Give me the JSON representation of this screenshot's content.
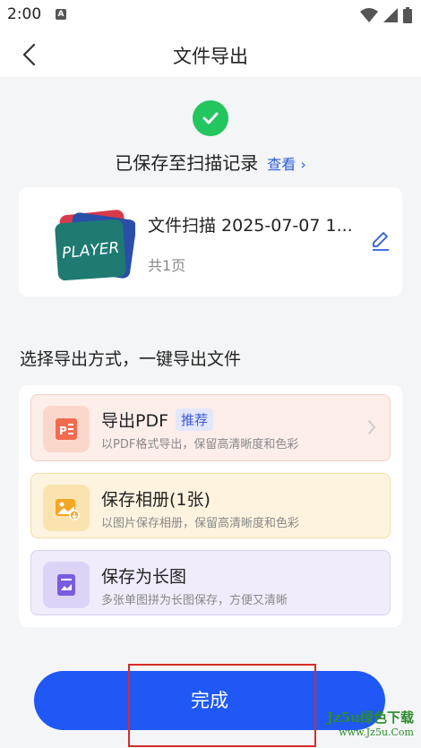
{
  "status_bar": {
    "time": "2:00",
    "a_icon": "A"
  },
  "header": {
    "title": "文件导出"
  },
  "saved": {
    "text": "已保存至扫描记录",
    "view_link": "查看 ›"
  },
  "document": {
    "name": "文件扫描 2025-07-07 1...",
    "pages": "共1页",
    "thumb_text": "PLAYER"
  },
  "section_title": "选择导出方式，一键导出文件",
  "options": [
    {
      "title": "导出PDF",
      "badge": "推荐",
      "subtitle": "以PDF格式导出，保留高清晰度和色彩",
      "icon": "pdf-icon"
    },
    {
      "title": "保存相册(1张)",
      "subtitle": "以图片保存相册，保留高清晰度和色彩",
      "icon": "album-icon"
    },
    {
      "title": "保存为长图",
      "subtitle": "多张单图拼为长图保存，方便又清晰",
      "icon": "long-image-icon"
    }
  ],
  "done_button": "完成",
  "watermark": {
    "line1": "Jz5u绿色下载",
    "line2": "www.Jz5u.Com"
  },
  "colors": {
    "primary": "#1f58f5",
    "success": "#22c55e",
    "link": "#2b5cd9"
  }
}
